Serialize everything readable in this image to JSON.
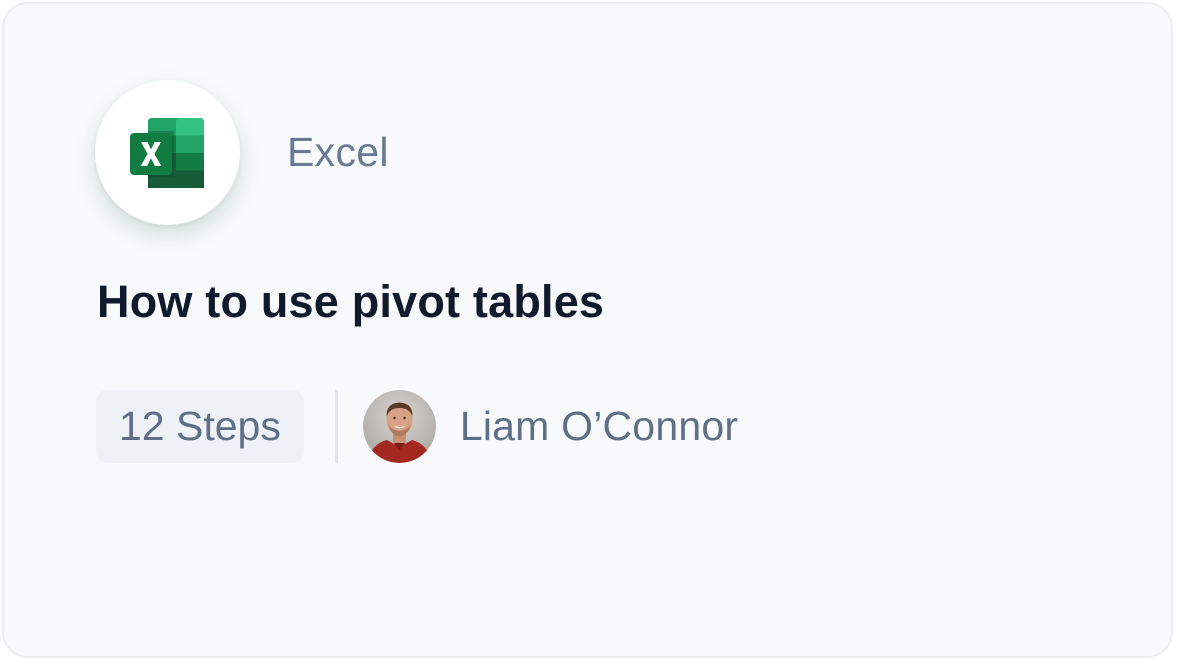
{
  "app": {
    "name": "Excel",
    "icon": "excel-icon",
    "brand_colors": {
      "dark_green": "#107c41",
      "mid_green": "#21a366",
      "light_green": "#33c481",
      "darker_green": "#185c37"
    }
  },
  "guide": {
    "title": "How to use pivot tables",
    "steps_label": "12 Steps"
  },
  "author": {
    "name": "Liam O’Connor",
    "avatar_icon": "author-avatar"
  },
  "colors": {
    "card_background": "#f8f9fb",
    "title_text": "#111a2c",
    "muted_text": "#6a7a92",
    "chip_background": "#eef1f6"
  }
}
